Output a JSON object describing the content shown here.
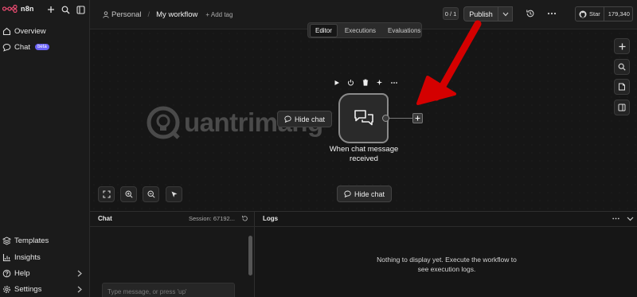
{
  "sidebar": {
    "brand": "n8n",
    "items_top": [
      {
        "label": "Overview",
        "icon": "home-icon"
      },
      {
        "label": "Chat",
        "icon": "chat-bubble-icon",
        "badge": "beta"
      }
    ],
    "items_bottom": [
      {
        "label": "Templates",
        "icon": "templates-icon"
      },
      {
        "label": "Insights",
        "icon": "insights-icon"
      },
      {
        "label": "Help",
        "icon": "help-icon"
      },
      {
        "label": "Settings",
        "icon": "settings-icon"
      }
    ]
  },
  "header": {
    "breadcrumb_project": "Personal",
    "breadcrumb_separator": "/",
    "workflow_name": "My workflow",
    "add_tag": "+ Add tag",
    "version": "0 / 1",
    "publish_label": "Publish",
    "github_star_label": "Star",
    "github_star_count": "179,340"
  },
  "tabs": [
    {
      "label": "Editor",
      "active": true
    },
    {
      "label": "Executions",
      "active": false
    },
    {
      "label": "Evaluations",
      "active": false
    }
  ],
  "canvas": {
    "node_label": "When chat message received",
    "hide_chat_tooltip": "Hide chat",
    "hide_chat_button": "Hide chat",
    "watermark": "uantrimang"
  },
  "chat_panel": {
    "title": "Chat",
    "session": "Session: 67192...",
    "input_placeholder": "Type message, or press 'up'"
  },
  "logs_panel": {
    "title": "Logs",
    "empty_message": "Nothing to display yet. Execute the workflow to see execution logs."
  },
  "colors": {
    "background": "#131313",
    "sidebar": "#1b1b1b",
    "node_border": "#8a8a8a",
    "beta_badge": "#6b63f6",
    "annotation_arrow": "#d40000"
  }
}
